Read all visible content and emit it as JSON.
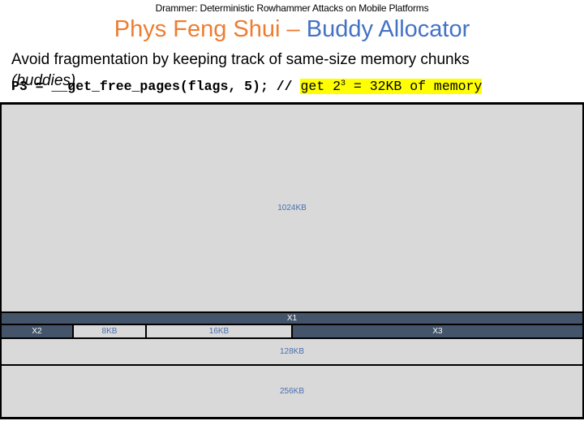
{
  "header": {
    "subtitle": "Drammer: Deterministic Rowhammer Attacks on Mobile Platforms",
    "title_part1": "Phys Feng Shui – ",
    "title_part2": "Buddy Allocator"
  },
  "content": {
    "bullet": "Avoid fragmentation by keeping track of same-size memory chunks",
    "bullet_continued": "(buddies)",
    "code_prefix": "P3 = __get_free_pages(flags, 5); // ",
    "code_comment_a": "get 2",
    "code_comment_sup": "3",
    "code_comment_b": " = 32KB of memory"
  },
  "colors": {
    "title_accent": "#ed7d31",
    "title_primary": "#4472c4",
    "allocated_block": "#44546a",
    "free_block": "#d9d9d9",
    "highlight": "#ffff00"
  },
  "memory": {
    "blocks": {
      "b1024": "1024KB",
      "x1": "X1",
      "x2": "X2",
      "b8": "8KB",
      "b16": "16KB",
      "x3": "X3",
      "b128": "128KB",
      "b256": "256KB"
    }
  }
}
